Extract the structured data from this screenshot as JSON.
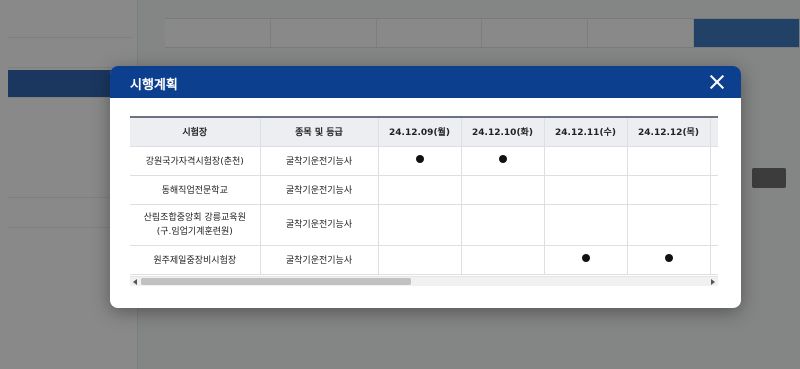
{
  "modal": {
    "title": "시행계획"
  },
  "table": {
    "headers": [
      "시험장",
      "종목 및 등급",
      "24.12.09(월)",
      "24.12.10(화)",
      "24.12.11(수)",
      "24.12.12(목)"
    ],
    "rows": [
      {
        "site": "강원국가자격시험장(춘천)",
        "site_line2": "",
        "exam": "굴착기운전기능사",
        "marks": [
          true,
          true,
          false,
          false
        ]
      },
      {
        "site": "동해직업전문학교",
        "site_line2": "",
        "exam": "굴착기운전기능사",
        "marks": [
          false,
          false,
          false,
          false
        ]
      },
      {
        "site": "산림조합중앙회 강릉교육원",
        "site_line2": "(구.임업기계훈련원)",
        "exam": "굴착기운전기능사",
        "marks": [
          false,
          false,
          false,
          false
        ]
      },
      {
        "site": "원주제일중장비시험장",
        "site_line2": "",
        "exam": "굴착기운전기능사",
        "marks": [
          false,
          false,
          true,
          true
        ]
      }
    ],
    "mark_symbol": "●"
  },
  "colors": {
    "header_bg": "#0d3f8f",
    "table_head_bg": "#eceef1",
    "active_tab": "#1a5fb4"
  },
  "icons": {
    "close": "close-icon",
    "scroll_left": "arrow-left-icon",
    "scroll_right": "arrow-right-icon"
  }
}
